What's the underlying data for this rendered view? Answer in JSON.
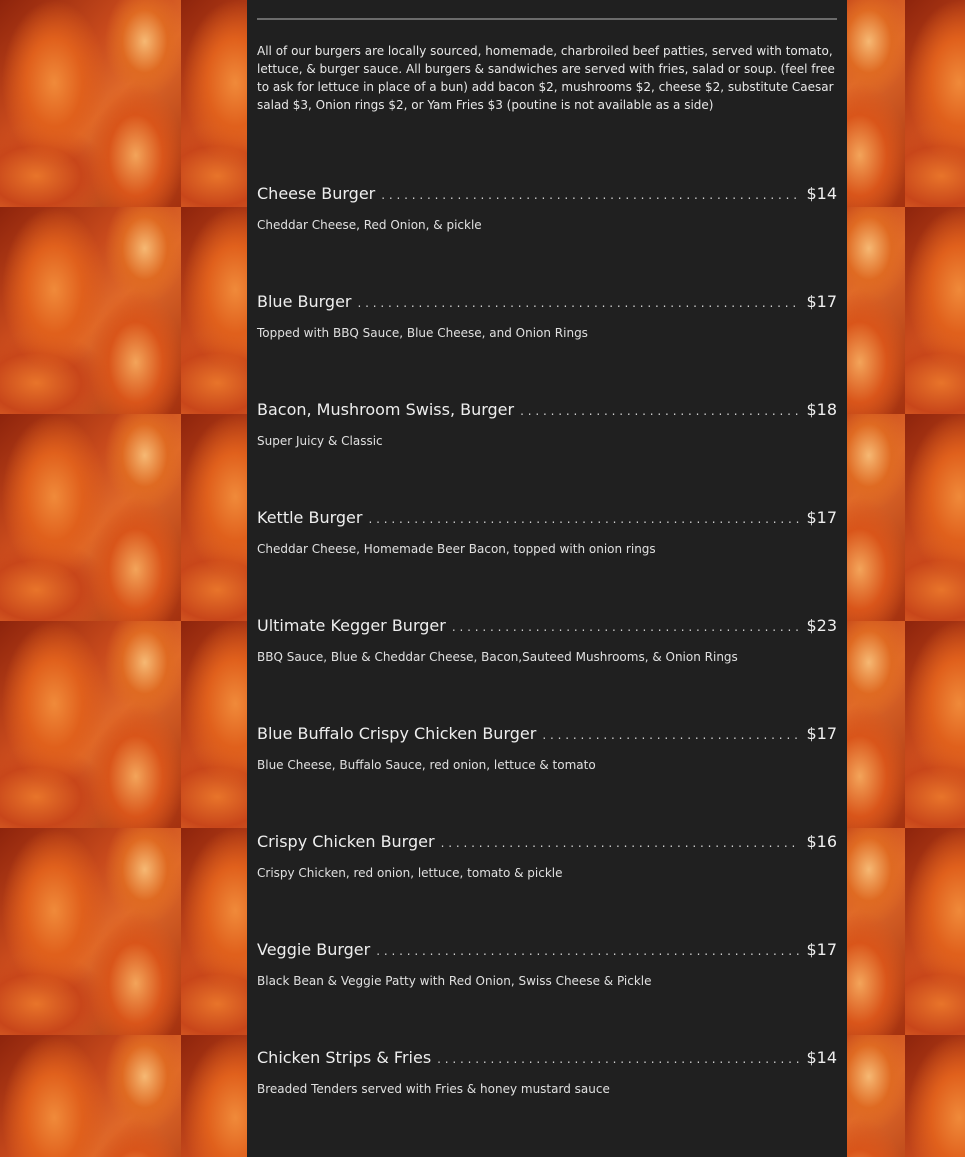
{
  "intro": "All of our burgers are locally sourced, homemade, charbroiled beef patties, served with tomato, lettuce, & burger sauce. All burgers & sandwiches are served with fries, salad or soup. (feel free to ask for lettuce in place of a bun) add bacon $2, mushrooms $2, cheese $2, substitute Caesar salad $3, Onion rings $2, or Yam Fries $3 (poutine is not available as a side)",
  "menu": [
    {
      "name": "Cheese Burger",
      "price": "$14",
      "desc": "Cheddar Cheese, Red Onion, & pickle"
    },
    {
      "name": "Blue Burger",
      "price": "$17",
      "desc": "Topped with BBQ Sauce, Blue Cheese, and Onion Rings"
    },
    {
      "name": "Bacon, Mushroom Swiss, Burger",
      "price": "$18",
      "desc": "Super Juicy & Classic"
    },
    {
      "name": "Kettle Burger",
      "price": "$17",
      "desc": "Cheddar Cheese, Homemade Beer Bacon, topped with onion rings"
    },
    {
      "name": "Ultimate Kegger Burger",
      "price": "$23",
      "desc": "BBQ Sauce, Blue & Cheddar Cheese, Bacon,Sauteed Mushrooms, & Onion Rings"
    },
    {
      "name": "Blue Buffalo Crispy Chicken Burger",
      "price": "$17",
      "desc": "Blue Cheese, Buffalo Sauce, red onion, lettuce & tomato"
    },
    {
      "name": "Crispy Chicken Burger",
      "price": "$16",
      "desc": "Crispy Chicken, red onion, lettuce, tomato & pickle"
    },
    {
      "name": "Veggie Burger",
      "price": "$17",
      "desc": "Black Bean & Veggie Patty with Red Onion, Swiss Cheese & Pickle"
    },
    {
      "name": "Chicken Strips & Fries",
      "price": "$14",
      "desc": "Breaded Tenders served with Fries & honey mustard sauce"
    }
  ]
}
